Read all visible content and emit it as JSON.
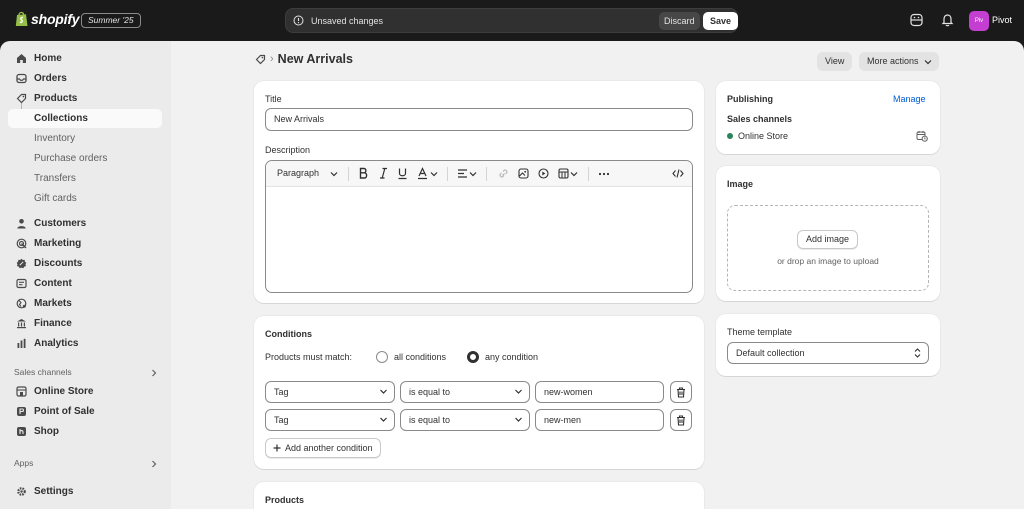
{
  "topbar": {
    "brand": "shopify",
    "edition": "Summer '25",
    "unsaved_text": "Unsaved changes",
    "discard_label": "Discard",
    "save_label": "Save",
    "avatar_initials": "Piv",
    "store_name": "Pivot",
    "colors": {
      "bg": "#1a1a1a",
      "avatar": "#c43ed1"
    }
  },
  "sidebar": {
    "items": [
      {
        "label": "Home",
        "icon": "home-icon"
      },
      {
        "label": "Orders",
        "icon": "inbox-icon"
      },
      {
        "label": "Products",
        "icon": "tag-icon"
      },
      {
        "label": "Collections",
        "sub": true,
        "active": true
      },
      {
        "label": "Inventory",
        "sub": true
      },
      {
        "label": "Purchase orders",
        "sub": true
      },
      {
        "label": "Transfers",
        "sub": true
      },
      {
        "label": "Gift cards",
        "sub": true
      },
      {
        "label": "Customers",
        "icon": "person-icon"
      },
      {
        "label": "Marketing",
        "icon": "target-icon"
      },
      {
        "label": "Discounts",
        "icon": "discount-icon"
      },
      {
        "label": "Content",
        "icon": "content-icon"
      },
      {
        "label": "Markets",
        "icon": "globe-icon"
      },
      {
        "label": "Finance",
        "icon": "bank-icon"
      },
      {
        "label": "Analytics",
        "icon": "bar-chart-icon"
      }
    ],
    "sales_channels_heading": "Sales channels",
    "channels": [
      {
        "label": "Online Store",
        "icon": "store-icon"
      },
      {
        "label": "Point of Sale",
        "icon": "pos-icon"
      },
      {
        "label": "Shop",
        "icon": "shop-icon"
      }
    ],
    "apps_heading": "Apps",
    "settings_label": "Settings"
  },
  "page": {
    "breadcrumb_sep": "›",
    "title": "New Arrivals",
    "view_label": "View",
    "more_actions_label": "More actions"
  },
  "details": {
    "title_label": "Title",
    "title_value": "New Arrivals",
    "description_label": "Description",
    "paragraph_label": "Paragraph"
  },
  "conditions": {
    "heading": "Conditions",
    "match_label": "Products must match:",
    "all_label": "all conditions",
    "any_label": "any condition",
    "selected": "any",
    "rows": [
      {
        "field": "Tag",
        "operator": "is equal to",
        "value": "new-women"
      },
      {
        "field": "Tag",
        "operator": "is equal to",
        "value": "new-men"
      }
    ],
    "add_label": "Add another condition"
  },
  "products": {
    "heading": "Products"
  },
  "publishing": {
    "heading": "Publishing",
    "manage_label": "Manage",
    "channels_label": "Sales channels",
    "channel": "Online Store",
    "status_color": "#29845a",
    "link_color": "#005bd3"
  },
  "image": {
    "heading": "Image",
    "add_label": "Add image",
    "hint": "or drop an image to upload"
  },
  "theme": {
    "heading": "Theme template",
    "value": "Default collection"
  }
}
